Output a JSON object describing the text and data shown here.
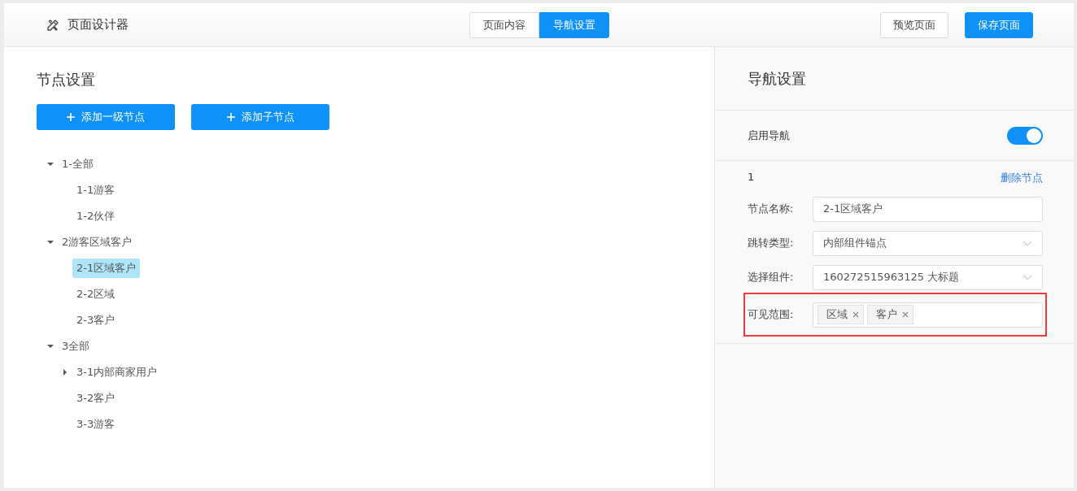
{
  "header": {
    "title": "页面设计器",
    "tabs": [
      {
        "label": "页面内容",
        "selected": false
      },
      {
        "label": "导航设置",
        "selected": true
      }
    ],
    "buttons": [
      {
        "label": "预览页面",
        "kind": "default"
      },
      {
        "label": "保存页面",
        "kind": "primary"
      }
    ]
  },
  "node_settings": {
    "title": "节点设置",
    "buttons": [
      "添加一级节点",
      "添加子节点"
    ],
    "tree": [
      {
        "label": "1-全部",
        "kind": "branch",
        "expanded": true,
        "selected": false,
        "children": [
          {
            "label": "1-1游客",
            "kind": "leaf",
            "selected": false
          },
          {
            "label": "1-2伙伴",
            "kind": "leaf",
            "selected": false
          }
        ]
      },
      {
        "label": "2游客区域客户",
        "kind": "branch",
        "expanded": true,
        "selected": false,
        "children": [
          {
            "label": "2-1区域客户",
            "kind": "leaf",
            "selected": true
          },
          {
            "label": "2-2区域",
            "kind": "leaf",
            "selected": false
          },
          {
            "label": "2-3客户",
            "kind": "leaf",
            "selected": false
          }
        ]
      },
      {
        "label": "3全部",
        "kind": "branch",
        "expanded": true,
        "selected": false,
        "children": [
          {
            "label": "3-1内部商家用户",
            "kind": "branch",
            "expanded": false,
            "selected": false
          },
          {
            "label": "3-2客户",
            "kind": "leaf",
            "selected": false
          },
          {
            "label": "3-3游客",
            "kind": "leaf",
            "selected": false
          }
        ]
      }
    ]
  },
  "nav_settings": {
    "title": "导航设置",
    "enable_label": "启用导航",
    "enabled": true,
    "node_index": "1",
    "delete_link": "删除节点",
    "fields": [
      {
        "label": "节点名称:",
        "kind": "text",
        "value": "2-1区域客户",
        "highlighted": false
      },
      {
        "label": "跳转类型:",
        "kind": "select",
        "value": "内部组件锚点",
        "highlighted": false
      },
      {
        "label": "选择组件:",
        "kind": "select",
        "value": "160272515963125 大标题",
        "highlighted": false
      },
      {
        "label": "可见范围:",
        "kind": "tags",
        "tags": [
          "区域",
          "客户"
        ],
        "highlighted": true
      }
    ]
  }
}
